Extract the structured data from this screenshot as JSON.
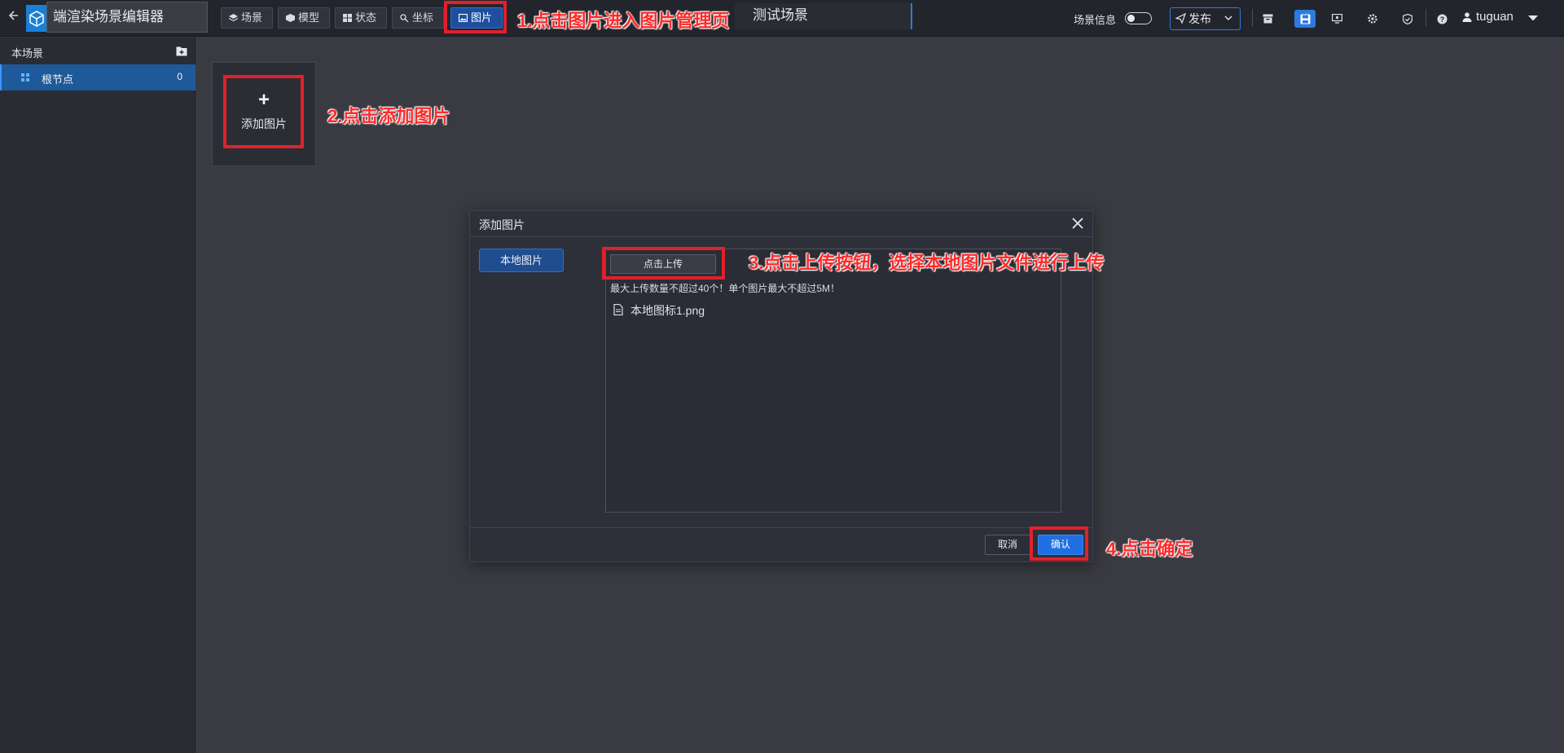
{
  "header": {
    "back_icon": "arrow-left-icon",
    "logo_icon": "cube-logo-icon",
    "app_title": "端渲染场景编辑器",
    "nav": [
      {
        "label": "场景",
        "icon": "layers-icon"
      },
      {
        "label": "模型",
        "icon": "cube-icon"
      },
      {
        "label": "状态",
        "icon": "grid-icon"
      },
      {
        "label": "坐标",
        "icon": "location-icon"
      },
      {
        "label": "图片",
        "icon": "image-icon",
        "active": true
      }
    ],
    "scene_name": "测试场景",
    "scene_info_label": "场景信息",
    "scene_info_toggle": false,
    "publish_label": "发布",
    "tool_icons": [
      "archive-icon",
      "save-icon",
      "screen-icon",
      "settings-icon",
      "shield-icon",
      "help-icon"
    ],
    "username": "tuguan"
  },
  "sidebar": {
    "title": "本场景",
    "add_folder_icon": "folder-add-icon",
    "items": [
      {
        "label": "根节点",
        "count": "0",
        "icon": "grid-icon"
      }
    ]
  },
  "main": {
    "add_card_plus": "+",
    "add_card_label": "添加图片"
  },
  "modal": {
    "title": "添加图片",
    "close_icon": "close-icon",
    "source_tab": "本地图片",
    "upload_button": "点击上传",
    "upload_hint": "最大上传数量不超过40个！单个图片最大不超过5M！",
    "files": [
      "本地图标1.png"
    ],
    "cancel_label": "取消",
    "confirm_label": "确认"
  },
  "annotations": {
    "step1": "1.点击图片进入图片管理页",
    "step2": "2.点击添加图片",
    "step3": "3.点击上传按钮，选择本地图片文件进行上传",
    "step4": "4.点击确定"
  },
  "colors": {
    "accent": "#2c7be0",
    "annotation": "#e0212b",
    "background": "#3a3b42",
    "sidebar_selected": "#1e5a99"
  }
}
